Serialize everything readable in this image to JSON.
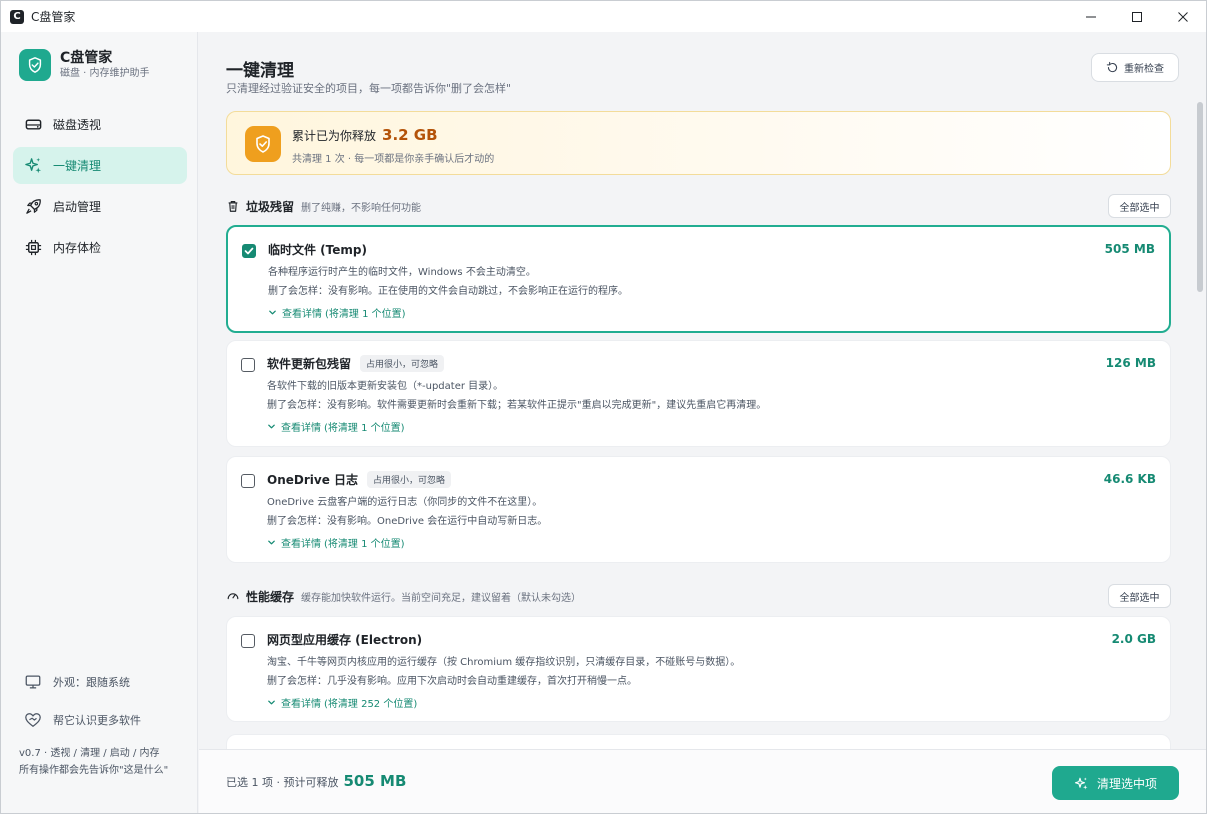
{
  "window": {
    "title": "C盘管家",
    "logo_letter": "C"
  },
  "brand": {
    "name": "C盘管家",
    "subtitle": "磁盘 · 内存维护助手"
  },
  "nav": {
    "items": [
      {
        "label": "磁盘透视",
        "icon": "disk-icon",
        "active": false
      },
      {
        "label": "一键清理",
        "icon": "sparkle-icon",
        "active": true
      },
      {
        "label": "启动管理",
        "icon": "rocket-icon",
        "active": false
      },
      {
        "label": "内存体检",
        "icon": "chip-icon",
        "active": false
      }
    ]
  },
  "sidebar_footer": {
    "appearance": "外观：跟随系统",
    "recommend": "帮它认识更多软件",
    "version": "v0.7 · 透视 / 清理 / 启动 / 内存",
    "version_note": "所有操作都会先告诉你\"这是什么\""
  },
  "page": {
    "title": "一键清理",
    "subtitle": "只清理经过验证安全的项目，每一项都告诉你\"删了会怎样\"",
    "recheck_label": "重新检查"
  },
  "banner": {
    "prefix": "累计已为你释放",
    "amount": "3.2 GB",
    "note": "共清理 1 次 · 每一项都是你亲手确认后才动的"
  },
  "sections": [
    {
      "title": "垃圾残留",
      "desc": "删了纯赚，不影响任何功能",
      "select_all": "全部选中",
      "items": [
        {
          "title": "临时文件 (Temp)",
          "tag": "",
          "size": "505 MB",
          "checked": true,
          "desc": "各种程序运行时产生的临时文件，Windows 不会主动清空。",
          "effect": "删了会怎样：没有影响。正在使用的文件会自动跳过，不会影响正在运行的程序。",
          "detail": "查看详情",
          "detail_note": "(将清理 1 个位置)"
        },
        {
          "title": "软件更新包残留",
          "tag": "占用很小，可忽略",
          "size": "126 MB",
          "checked": false,
          "desc": "各软件下载的旧版本更新安装包（*-updater 目录）。",
          "effect": "删了会怎样：没有影响。软件需要更新时会重新下载；若某软件正提示\"重启以完成更新\"，建议先重启它再清理。",
          "detail": "查看详情",
          "detail_note": "(将清理 1 个位置)"
        },
        {
          "title": "OneDrive 日志",
          "tag": "占用很小，可忽略",
          "size": "46.6 KB",
          "checked": false,
          "desc": "OneDrive 云盘客户端的运行日志（你同步的文件不在这里）。",
          "effect": "删了会怎样：没有影响。OneDrive 会在运行中自动写新日志。",
          "detail": "查看详情",
          "detail_note": "(将清理 1 个位置)"
        }
      ]
    },
    {
      "title": "性能缓存",
      "desc": "缓存能加快软件运行。当前空间充足，建议留着（默认未勾选）",
      "select_all": "全部选中",
      "items": [
        {
          "title": "网页型应用缓存 (Electron)",
          "tag": "",
          "size": "2.0 GB",
          "checked": false,
          "desc": "淘宝、千牛等网页内核应用的运行缓存（按 Chromium 缓存指纹识别，只清缓存目录，不碰账号与数据）。",
          "effect": "删了会怎样：几乎没有影响。应用下次启动时会自动重建缓存，首次打开稍慢一点。",
          "detail": "查看详情",
          "detail_note": "(将清理 252 个位置)"
        }
      ]
    }
  ],
  "footer": {
    "prefix": "已选 1 项 · 预计可释放",
    "amount": "505 MB",
    "clean_label": "清理选中项"
  },
  "colors": {
    "accent": "#1fa98f",
    "accent_dark": "#168a73",
    "nav_active_bg": "#d6f3ec",
    "banner_amount": "#b45309",
    "banner_icon": "#ef9f1e"
  }
}
